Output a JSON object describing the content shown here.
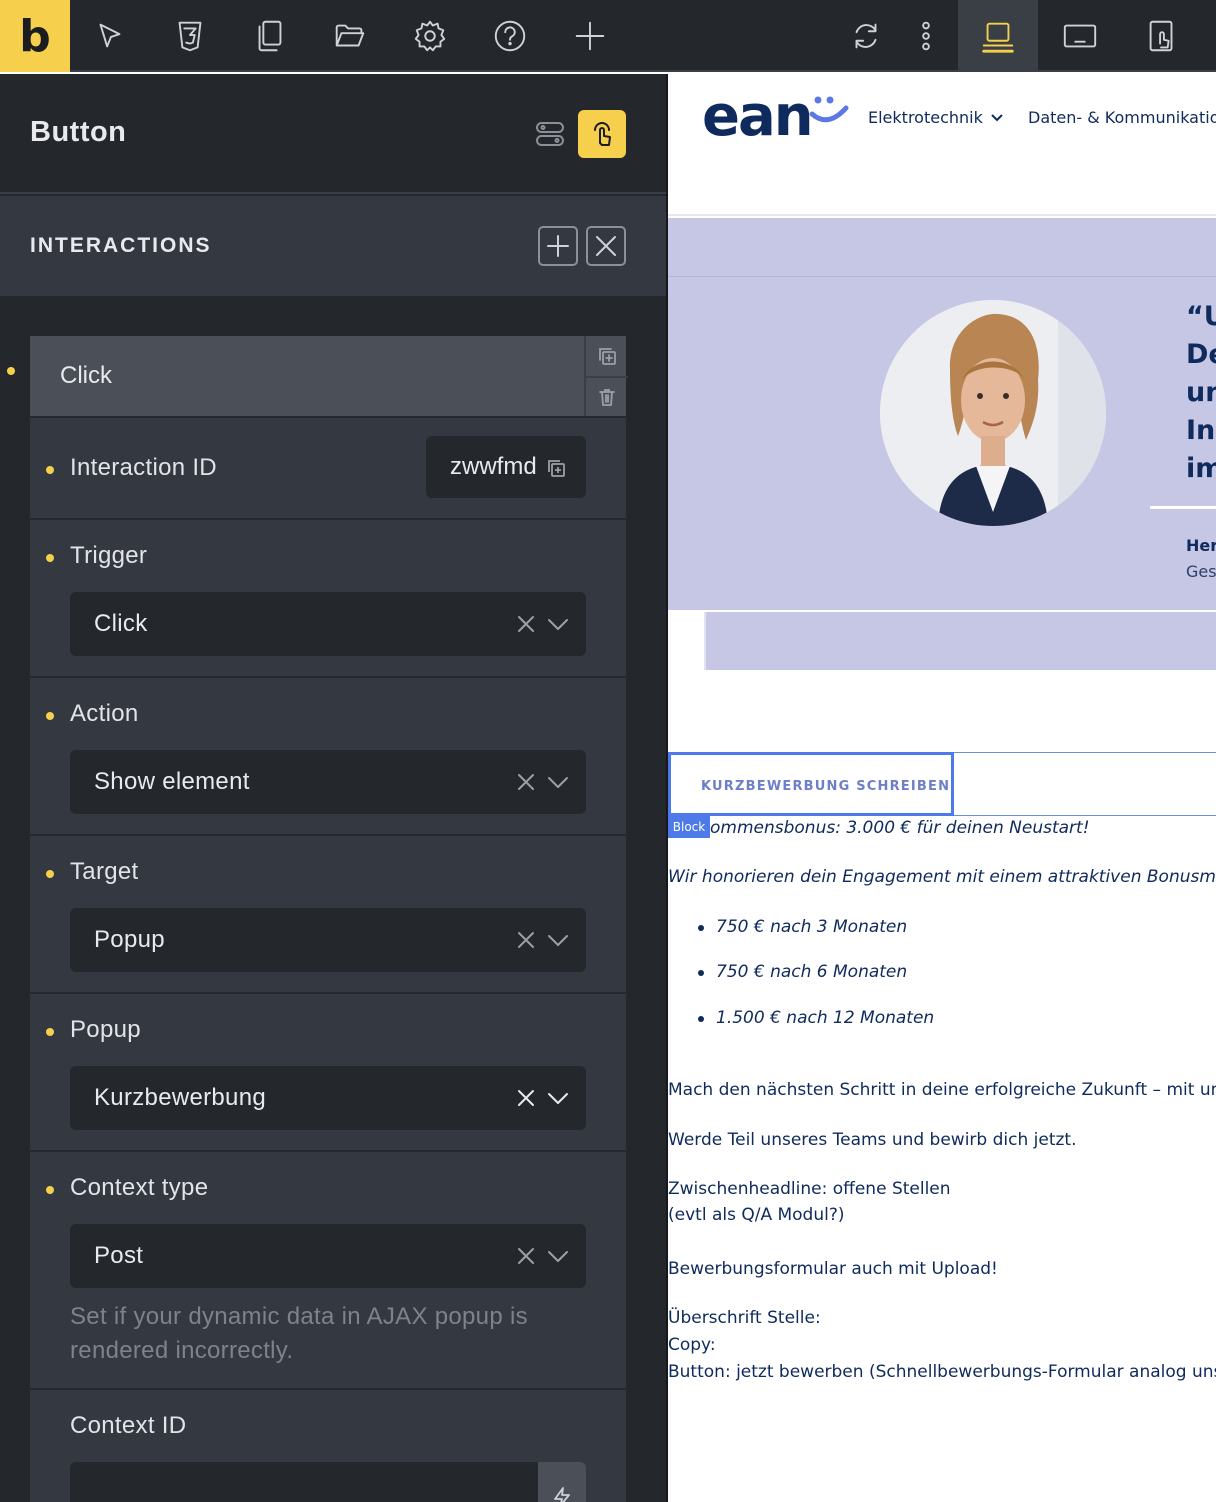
{
  "toolbar": {
    "logo": "b",
    "icons": [
      "cursor-icon",
      "css3-icon",
      "pages-icon",
      "folder-icon",
      "settings-icon",
      "help-icon",
      "plus-icon",
      "refresh-icon",
      "more-vertical-icon",
      "desktop-breakpoint-icon",
      "tablet-landscape-icon",
      "tablet-portrait-icon"
    ],
    "active": "desktop-breakpoint-icon",
    "accent": "#f6d04d"
  },
  "panel": {
    "title": "Button",
    "section_title": "INTERACTIONS",
    "interaction": {
      "name": "Click",
      "id_label": "Interaction ID",
      "id_value": "zwwfmd",
      "trigger_label": "Trigger",
      "trigger_value": "Click",
      "action_label": "Action",
      "action_value": "Show element",
      "target_label": "Target",
      "target_value": "Popup",
      "popup_label": "Popup",
      "popup_value": "Kurzbewerbung",
      "context_type_label": "Context type",
      "context_type_value": "Post",
      "context_hint": "Set if your dynamic data in AJAX popup is rendered incorrectly.",
      "context_id_label": "Context ID",
      "context_id_value": ""
    }
  },
  "preview": {
    "logo": "ean",
    "nav": [
      "Elektrotechnik",
      "Daten- & Kommunikation"
    ],
    "hero_quote": "“U\nDe\nun\nInn\nim",
    "hero_name": "Her",
    "hero_role": "Ges",
    "button_label": "KURZBEWERBUNG SCHREIBEN",
    "block_tag": "Block",
    "bonus_line": "ommensbonus: 3.000 € für deinen Neustart!",
    "bonus_intro": "Wir honorieren dein Engagement mit einem attraktiven Bonusmodell",
    "bonus_items": [
      "750 € nach 3 Monaten",
      "750 € nach 6 Monaten",
      "1.500 € nach 12 Monaten"
    ],
    "p1": "Mach den nächsten Schritt in deine erfolgreiche Zukunft – mit uns!",
    "p2": "Werde Teil unseres Teams und bewirb dich jetzt.",
    "p3a": "Zwischenheadline: offene Stellen",
    "p3b": "(evtl als Q/A Modul?)",
    "p4": "Bewerbungsformular auch mit Upload!",
    "p5a": "Überschrift Stelle:",
    "p5b": "Copy:",
    "p5c": "Button: jetzt bewerben (Schnellbewerbungs-Formular analog unserer"
  }
}
